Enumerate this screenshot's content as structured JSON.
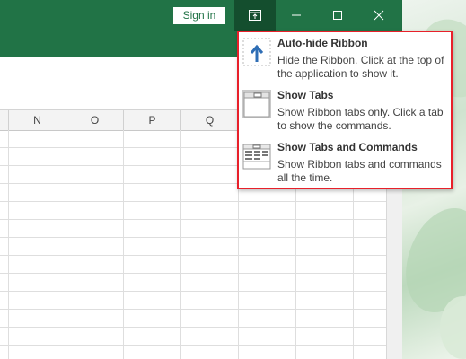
{
  "titlebar": {
    "sign_in_label": "Sign in",
    "ribbon_display_options_icon": "ribbon-display-options-icon",
    "minimize_icon": "minimize-icon",
    "maximize_icon": "maximize-icon",
    "close_icon": "close-icon"
  },
  "columns": [
    "N",
    "O",
    "P",
    "Q"
  ],
  "menu": {
    "items": [
      {
        "title": "Auto-hide Ribbon",
        "description": "Hide the Ribbon. Click at the top of the application to show it.",
        "icon": "auto-hide-ribbon-icon"
      },
      {
        "title": "Show Tabs",
        "description": "Show Ribbon tabs only. Click a tab to show the commands.",
        "icon": "show-tabs-icon"
      },
      {
        "title": "Show Tabs and Commands",
        "description": "Show Ribbon tabs and commands all the time.",
        "icon": "show-tabs-and-commands-icon"
      }
    ]
  },
  "colors": {
    "excel_green": "#217346",
    "highlight_border": "#e8202a"
  }
}
